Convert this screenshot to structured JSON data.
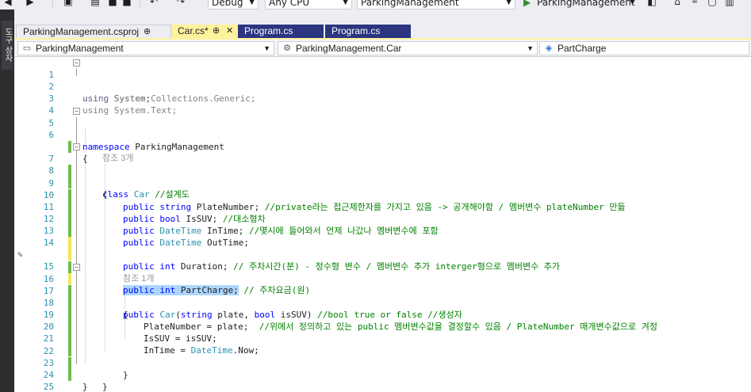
{
  "toolbar": {
    "config": "Debug",
    "platform": "Any CPU",
    "project": "ParkingManagement",
    "run_target": "ParkingManagement"
  },
  "left_strip": {
    "label": "도구 상자"
  },
  "tabs": [
    {
      "label": "ParkingManagement.csproj",
      "pin": "⊕",
      "state": "grayish"
    },
    {
      "label": "Car.cs*",
      "pin": "⊕",
      "close": "✕",
      "state": "active"
    },
    {
      "label": "Program.cs",
      "state": "inactive"
    },
    {
      "label": "Program.cs",
      "state": "inactive"
    }
  ],
  "nav": {
    "project_combo": "ParkingManagement",
    "type_combo": "ParkingManagement.Car",
    "member_combo": "PartCharge"
  },
  "editor": {
    "line_numbers": [
      "1",
      "2",
      "3",
      "4",
      "5",
      "6",
      "7",
      "8",
      "9",
      "10",
      "11",
      "12",
      "13",
      "14",
      "15",
      "16",
      "17",
      "18",
      "19",
      "20",
      "21",
      "22",
      "23",
      "24",
      "25"
    ],
    "code": {
      "l1_using": "using",
      "l1_rest": " System;",
      "l2": "using System.Collections.Generic;",
      "l3": "using System.Text;",
      "l5_kw": "namespace",
      "l5_rest": " ParkingManagement",
      "l6": "{",
      "lens_class": "참조 3개",
      "l7_kw": "class",
      "l7_type": "Car",
      "l7_comment": " //설계도",
      "l8": "{",
      "l9_kw": "public",
      "l9_type": "string",
      "l9_name": " PlateNumber;",
      "l9_comment": " //private라는 접근제한자를 가지고 있음 -> 공개해야함 / 멤버변수 plateNumber 만듦",
      "l10_kw": "public",
      "l10_type": "bool",
      "l10_name": " IsSUV;",
      "l10_comment": " //대소형차",
      "l11_kw": "public",
      "l11_type": "DateTime",
      "l11_name": " InTime;",
      "l11_comment": " //몇시에 들어와서 언제 나갔나 멤버변수에 포함",
      "l12_kw": "public",
      "l12_type": "DateTime",
      "l12_name": " OutTime;",
      "l14_kw": "public",
      "l14_type": "int",
      "l14_name": " Duration;",
      "l14_comment": " // 주차시간(분) - 정수형 변수 / 멤버변수 추가 interger형으로 멤버변수 추가",
      "l15_kw": "public",
      "l15_type": "int",
      "l15_name": " PartCharge;",
      "l15_comment": " // 주차요금(원)",
      "lens_ctor": "참조 1개",
      "l16_kw": "public",
      "l16_type": "Car",
      "l16_open": "(",
      "l16_t1": "string",
      "l16_p1": " plate, ",
      "l16_t2": "bool",
      "l16_p2": " isSUV)",
      "l16_comment": " //bool true or false //생성자",
      "l17": "{",
      "l18_code": "PlateNumber = plate;",
      "l18_comment": "  //위에서 정의하고 있는 public 멤버변수값을 결정할수 있음 / PlateNumber 매개변수값으로 겨정",
      "l19": "IsSUV = isSUV;",
      "l20_a": "InTime = ",
      "l20_type": "DateTime",
      "l20_b": ".Now;",
      "l22": "}",
      "l23": "}",
      "l24": "}"
    }
  }
}
